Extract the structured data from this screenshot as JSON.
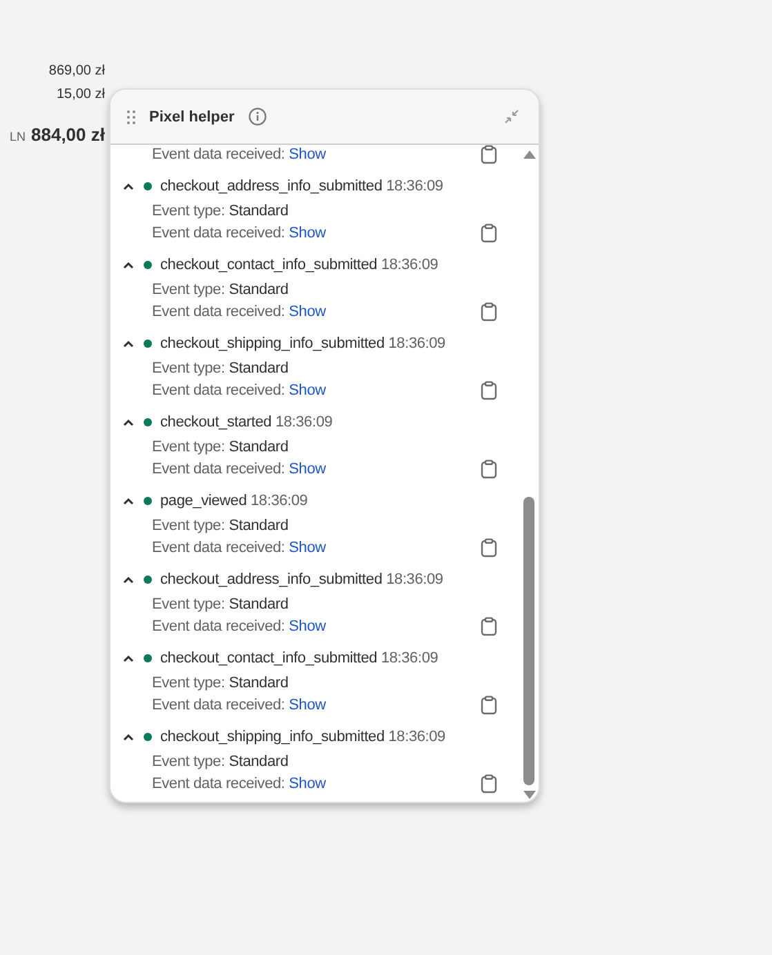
{
  "order_summary": {
    "lines": [
      {
        "amount": "869,00 zł"
      },
      {
        "amount": "15,00 zł"
      }
    ],
    "total": {
      "currency": "LN",
      "amount": "884,00 zł"
    }
  },
  "panel": {
    "title": "Pixel helper",
    "partial_event": {
      "data_label": "Event data received:",
      "data_link": "Show"
    },
    "events": [
      {
        "name": "checkout_address_info_submitted",
        "time": "18:36:09",
        "expanded": true,
        "type_label": "Event type:",
        "type_value": "Standard",
        "data_label": "Event data received:",
        "data_link": "Show"
      },
      {
        "name": "checkout_contact_info_submitted",
        "time": "18:36:09",
        "expanded": true,
        "type_label": "Event type:",
        "type_value": "Standard",
        "data_label": "Event data received:",
        "data_link": "Show"
      },
      {
        "name": "checkout_shipping_info_submitted",
        "time": "18:36:09",
        "expanded": true,
        "type_label": "Event type:",
        "type_value": "Standard",
        "data_label": "Event data received:",
        "data_link": "Show"
      },
      {
        "name": "checkout_started",
        "time": "18:36:09",
        "expanded": true,
        "type_label": "Event type:",
        "type_value": "Standard",
        "data_label": "Event data received:",
        "data_link": "Show"
      },
      {
        "name": "page_viewed",
        "time": "18:36:09",
        "expanded": true,
        "type_label": "Event type:",
        "type_value": "Standard",
        "data_label": "Event data received:",
        "data_link": "Show"
      },
      {
        "name": "checkout_address_info_submitted",
        "time": "18:36:09",
        "expanded": true,
        "type_label": "Event type:",
        "type_value": "Standard",
        "data_label": "Event data received:",
        "data_link": "Show"
      },
      {
        "name": "checkout_contact_info_submitted",
        "time": "18:36:09",
        "expanded": true,
        "type_label": "Event type:",
        "type_value": "Standard",
        "data_label": "Event data received:",
        "data_link": "Show"
      },
      {
        "name": "checkout_shipping_info_submitted",
        "time": "18:36:09",
        "expanded": true,
        "type_label": "Event type:",
        "type_value": "Standard",
        "data_label": "Event data received:",
        "data_link": "Show"
      }
    ]
  }
}
